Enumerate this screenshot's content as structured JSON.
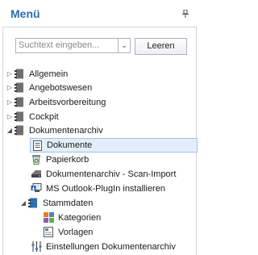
{
  "header": {
    "title": "Menü"
  },
  "search": {
    "placeholder": "Suchtext eingeben...",
    "button": "Leeren"
  },
  "tree": {
    "allgemein": "Allgemein",
    "angebotswesen": "Angebotswesen",
    "arbeitsvorbereitung": "Arbeitsvorbereitung",
    "cockpit": "Cockpit",
    "dokumentenarchiv": "Dokumentenarchiv",
    "dokumente": "Dokumente",
    "papierkorb": "Papierkorb",
    "scan_import": "Dokumentenarchiv - Scan-Import",
    "outlook_plugin": "MS Outlook-PlugIn installieren",
    "stammdaten": "Stammdaten",
    "kategorien": "Kategorien",
    "vorlagen": "Vorlagen",
    "einstellungen": "Einstellungen Dokumentenarchiv"
  }
}
